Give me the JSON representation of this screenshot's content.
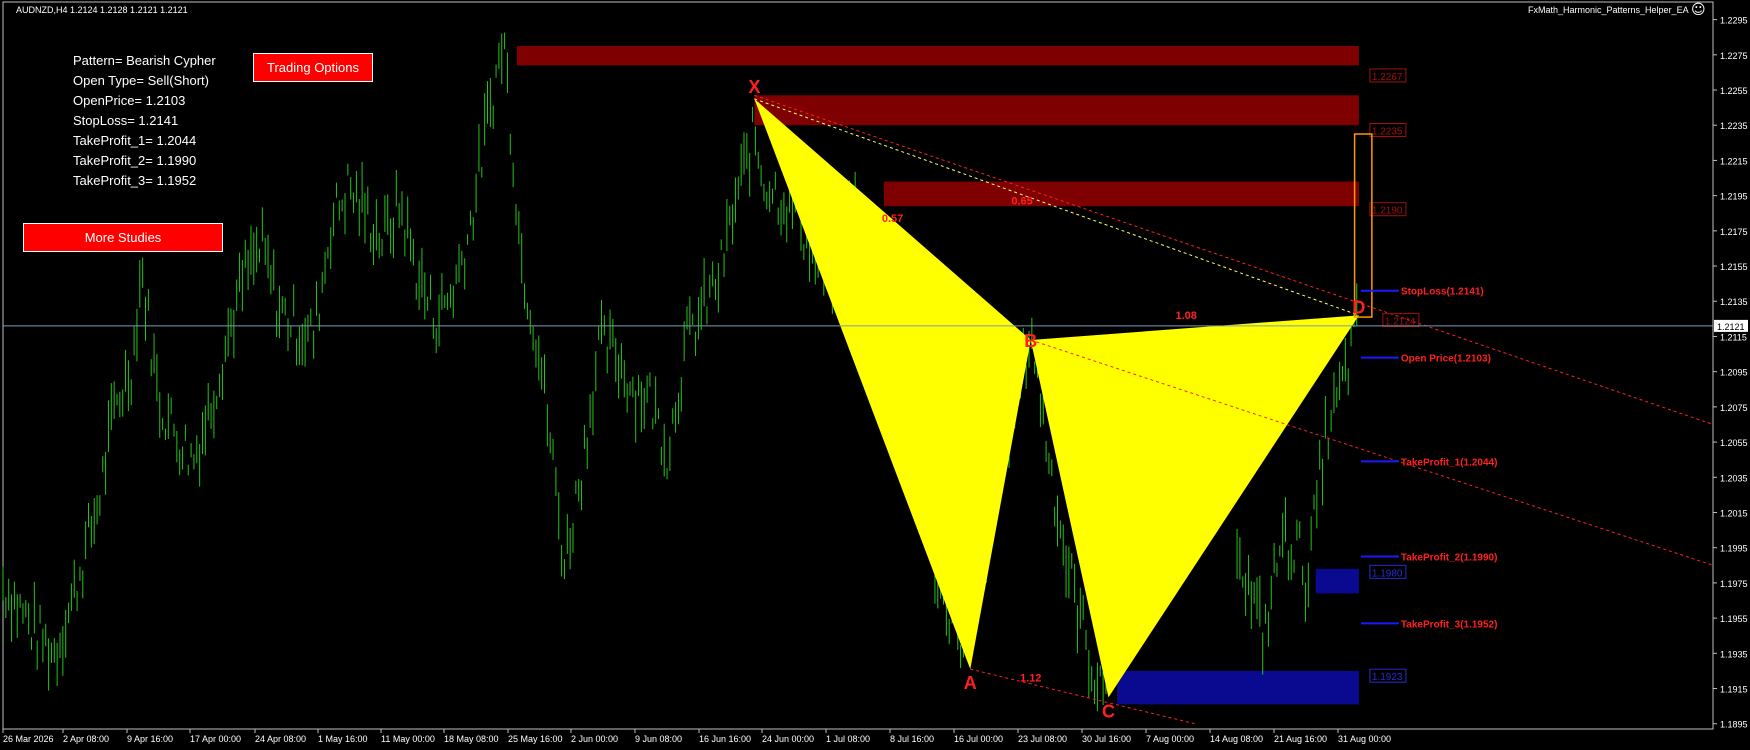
{
  "header": {
    "symbol_info": "AUDNZD,H4  1.2124 1.2128 1.2121 1.2121",
    "ea_name": "FxMath_Harmonic_Patterns_Helper_EA",
    "smiley": "☺"
  },
  "info_panel": {
    "lines": [
      "Pattern= Bearish Cypher",
      "Open Type= Sell(Short)",
      "OpenPrice= 1.2103",
      "StopLoss= 1.2141",
      "TakeProfit_1= 1.2044",
      "TakeProfit_2= 1.1990",
      "TakeProfit_3= 1.1952"
    ]
  },
  "buttons": {
    "trading_options": "Trading Options",
    "more_studies": "More Studies"
  },
  "colors": {
    "candle": "#22c516",
    "pattern_fill": "#ffff00",
    "zone_red": "#7f0000",
    "zone_blue": "#0a0a90",
    "label_red": "#ff2020",
    "level_line": "#1a1aff",
    "target_box": "#ff9900",
    "price_line": "#7a9ab8"
  },
  "chart_data": {
    "type": "line",
    "title": "",
    "xlabel": "",
    "ylabel": "",
    "ylim": [
      1.1892,
      1.2305
    ],
    "x_tick_labels": [
      "26 Mar 2026",
      "2 Apr 08:00",
      "9 Apr 16:00",
      "17 Apr 00:00",
      "24 Apr 08:00",
      "1 May 16:00",
      "11 May 00:00",
      "18 May 08:00",
      "25 May 16:00",
      "2 Jun 00:00",
      "9 Jun 08:00",
      "16 Jun 16:00",
      "24 Jun 00:00",
      "1 Jul 08:00",
      "8 Jul 16:00",
      "16 Jul 00:00",
      "23 Jul 08:00",
      "30 Jul 16:00",
      "7 Aug 00:00",
      "14 Aug 08:00",
      "21 Aug 16:00",
      "31 Aug 00:00"
    ],
    "y_tick_labels": [
      "1.2295",
      "1.2275",
      "1.2255",
      "1.2235",
      "1.2215",
      "1.2195",
      "1.2175",
      "1.2155",
      "1.2135",
      "1.2115",
      "1.2095",
      "1.2075",
      "1.2055",
      "1.2035",
      "1.2015",
      "1.1995",
      "1.1975",
      "1.1955",
      "1.1935",
      "1.1915",
      "1.1895"
    ],
    "current_price": "1.2121",
    "price_series": [
      [
        0,
        1.1975
      ],
      [
        4,
        1.1945
      ],
      [
        6,
        1.1935
      ],
      [
        8,
        1.1965
      ],
      [
        11,
        1.202
      ],
      [
        13,
        1.2075
      ],
      [
        15,
        1.21
      ],
      [
        16,
        1.2155
      ],
      [
        18,
        1.208
      ],
      [
        20,
        1.206
      ],
      [
        22,
        1.2045
      ],
      [
        24,
        1.2075
      ],
      [
        26,
        1.2115
      ],
      [
        28,
        1.215
      ],
      [
        30,
        1.2165
      ],
      [
        32,
        1.213
      ],
      [
        34,
        1.212
      ],
      [
        36,
        1.2115
      ],
      [
        38,
        1.218
      ],
      [
        40,
        1.22
      ],
      [
        42,
        1.2185
      ],
      [
        44,
        1.217
      ],
      [
        46,
        1.219
      ],
      [
        48,
        1.215
      ],
      [
        50,
        1.2125
      ],
      [
        52,
        1.214
      ],
      [
        54,
        1.2175
      ],
      [
        56,
        1.2235
      ],
      [
        58,
        1.2285
      ],
      [
        60,
        1.216
      ],
      [
        62,
        1.211
      ],
      [
        64,
        1.203
      ],
      [
        65,
        1.1985
      ],
      [
        67,
        1.204
      ],
      [
        69,
        1.211
      ],
      [
        71,
        1.2105
      ],
      [
        73,
        1.2085
      ],
      [
        75,
        1.208
      ],
      [
        77,
        1.205
      ],
      [
        79,
        1.211
      ],
      [
        81,
        1.213
      ],
      [
        83,
        1.215
      ],
      [
        85,
        1.2195
      ],
      [
        87,
        1.223
      ],
      [
        88,
        1.2205
      ],
      [
        90,
        1.2195
      ],
      [
        92,
        1.2185
      ],
      [
        94,
        1.216
      ],
      [
        96,
        1.215
      ],
      [
        98,
        1.219
      ],
      [
        100,
        1.218
      ],
      [
        102,
        1.212
      ],
      [
        104,
        1.207
      ],
      [
        106,
        1.203
      ],
      [
        108,
        1.1985
      ],
      [
        110,
        1.1955
      ],
      [
        112,
        1.193
      ],
      [
        114,
        1.2005
      ],
      [
        116,
        1.206
      ],
      [
        118,
        1.209
      ],
      [
        119,
        1.212
      ],
      [
        121,
        1.205
      ],
      [
        123,
        1.199
      ],
      [
        125,
        1.195
      ],
      [
        127,
        1.191
      ],
      [
        128,
        1.193
      ],
      [
        130,
        1.2
      ],
      [
        132,
        1.199
      ],
      [
        134,
        1.203
      ],
      [
        136,
        1.207
      ],
      [
        138,
        1.202
      ],
      [
        140,
        1.2065
      ],
      [
        142,
        1.203
      ],
      [
        144,
        1.1975
      ],
      [
        146,
        1.1945
      ],
      [
        148,
        1.2
      ],
      [
        150,
        1.1995
      ],
      [
        151,
        1.1975
      ],
      [
        153,
        1.2055
      ],
      [
        155,
        1.2085
      ],
      [
        157,
        1.2125
      ]
    ],
    "pattern": {
      "name": "Bearish Cypher",
      "points": [
        {
          "label": "X",
          "x": 87,
          "y": 1.225
        },
        {
          "label": "A",
          "x": 112,
          "y": 1.1926
        },
        {
          "label": "B",
          "x": 119,
          "y": 1.2113
        },
        {
          "label": "C",
          "x": 128,
          "y": 1.191
        },
        {
          "label": "D",
          "x": 157,
          "y": 1.2127
        }
      ],
      "ratios": [
        {
          "label": "0.57",
          "x": 103,
          "y": 1.218
        },
        {
          "label": "0.65",
          "x": 118,
          "y": 1.219
        },
        {
          "label": "1.08",
          "x": 137,
          "y": 1.2125
        },
        {
          "label": "1.12",
          "x": 119,
          "y": 1.1919
        }
      ]
    },
    "zones": [
      {
        "x0": 59.5,
        "x1": 157,
        "y0": 1.2269,
        "y1": 1.228,
        "color": "red",
        "label": "1.2267",
        "label_y": 1.2263
      },
      {
        "x0": 87,
        "x1": 157,
        "y0": 1.2235,
        "y1": 1.2252,
        "color": "red",
        "label": "1.2235",
        "label_y": 1.2232
      },
      {
        "x0": 102,
        "x1": 157,
        "y0": 1.2189,
        "y1": 1.2203,
        "color": "red",
        "label": "1.2190",
        "label_y": 1.2187
      },
      {
        "x0": 152,
        "x1": 157,
        "y0": 1.1969,
        "y1": 1.1983,
        "color": "blue",
        "label": "1.1980",
        "label_y": 1.1981
      },
      {
        "x0": 129,
        "x1": 157,
        "y0": 1.1906,
        "y1": 1.1925,
        "color": "blue",
        "label": "1.1923",
        "label_y": 1.1922
      }
    ],
    "target_box": {
      "x0": 156.5,
      "x1": 158.5,
      "y0": 1.2126,
      "y1": 1.223
    },
    "d_level_label": {
      "label": "1.2124",
      "y": 1.2124
    },
    "levels": [
      {
        "label": "StopLoss(1.2141)",
        "value": 1.2141
      },
      {
        "label": "Open Price(1.2103)",
        "value": 1.2103
      },
      {
        "label": "TakeProfit_1(1.2044)",
        "value": 1.2044
      },
      {
        "label": "TakeProfit_2(1.1990)",
        "value": 1.199
      },
      {
        "label": "TakeProfit_3(1.1952)",
        "value": 1.1952
      }
    ],
    "dotted_lines": [
      {
        "x0": 87,
        "y0": 1.2252,
        "x1": 198,
        "y1": 1.2065,
        "color": "red"
      },
      {
        "x0": 87,
        "y0": 1.225,
        "x1": 157,
        "y1": 1.2127,
        "color": "yellow"
      },
      {
        "x0": 119,
        "y0": 1.2113,
        "x1": 198,
        "y1": 1.1985,
        "color": "red"
      },
      {
        "x0": 112,
        "y0": 1.1926,
        "x1": 138,
        "y1": 1.1895,
        "color": "red"
      }
    ]
  }
}
